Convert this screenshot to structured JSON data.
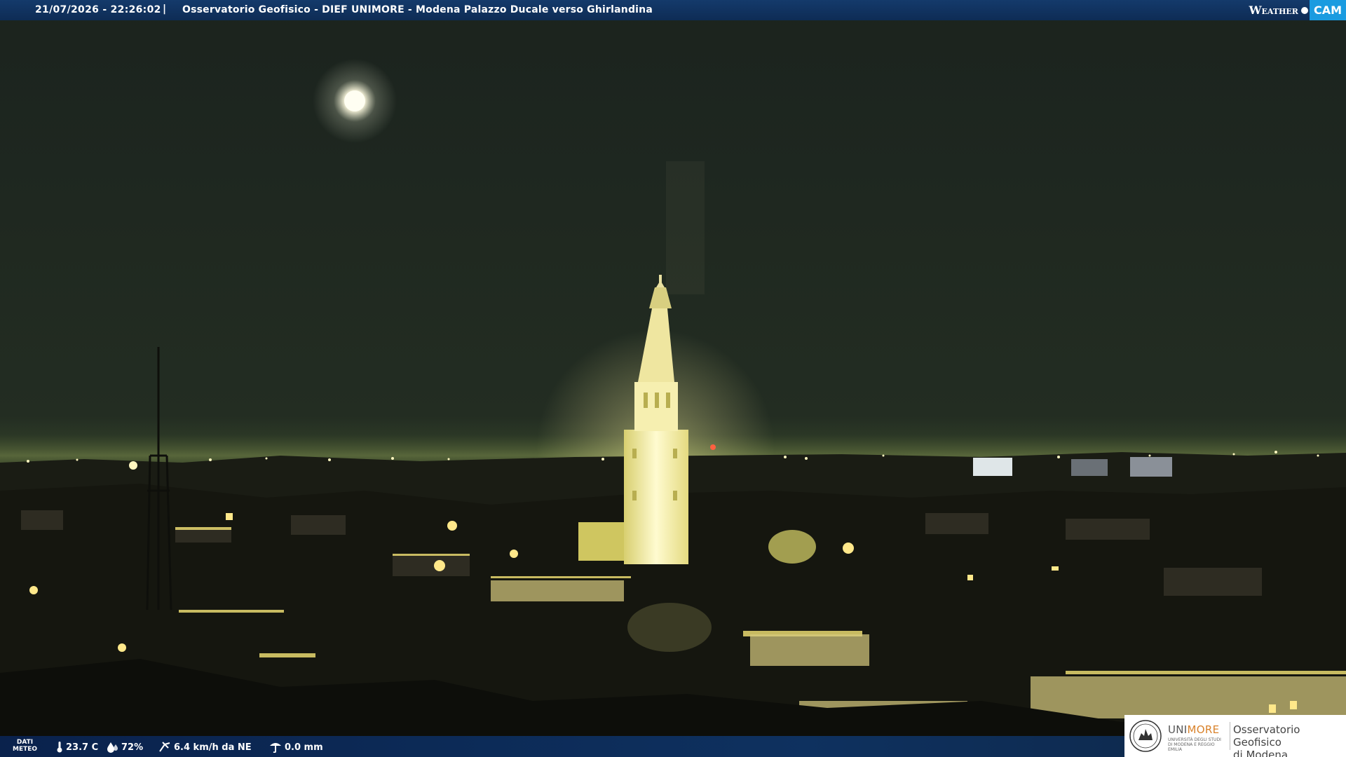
{
  "header": {
    "timestamp": "21/07/2026 - 22:26:02",
    "separator": "|",
    "caption": "Osservatorio Geofisico - DIEF UNIMORE - Modena Palazzo Ducale verso Ghirlandina",
    "brand_weather": "Weather",
    "brand_cam": "CAM"
  },
  "meteo": {
    "label_line1": "DATI",
    "label_line2": "METEO",
    "temperature": "23.7 C",
    "humidity": "72%",
    "wind": "6.4 km/h da NE",
    "rain": "0.0 mm"
  },
  "logo": {
    "unimore_prefix": "UNI",
    "unimore_accent": "MORE",
    "subtitle": "UNIVERSITÀ DEGLI STUDI DI MODENA E REGGIO EMILIA",
    "observatory_line1": "Osservatorio Geofisico",
    "observatory_line2": "di Modena"
  },
  "icons": [
    "thermometer-icon",
    "humidity-drop-icon",
    "wind-icon",
    "rain-gauge-icon"
  ],
  "colors": {
    "header_bar": "#143a6b",
    "brand_cam": "#1a9be0",
    "unimore_accent": "#d9822b",
    "sky": "#1f2a22",
    "floodlight": "#f3e67a"
  }
}
